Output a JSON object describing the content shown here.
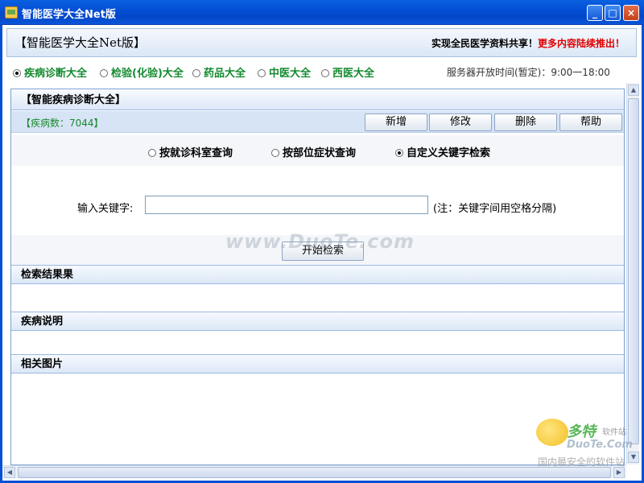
{
  "window": {
    "title": "智能医学大全Net版",
    "controls": {
      "minimize": "_",
      "maximize": "□",
      "close": "×"
    }
  },
  "header": {
    "brand": "【智能医学大全Net版】",
    "slogan_black": "实现全民医学资料共享！",
    "slogan_red": "更多内容陆续推出！"
  },
  "nav": {
    "items": [
      {
        "label": "疾病诊断大全",
        "selected": true
      },
      {
        "label": "检验(化验)大全",
        "selected": false
      },
      {
        "label": "药品大全",
        "selected": false
      },
      {
        "label": "中医大全",
        "selected": false
      },
      {
        "label": "西医大全",
        "selected": false
      }
    ],
    "server_time": "服务器开放时间(暂定)：9:00一18:00"
  },
  "panel": {
    "title": "【智能疾病诊断大全】",
    "count": "【疾病数：7044】",
    "buttons": [
      "新增",
      "修改",
      "删除",
      "帮助"
    ],
    "modes": [
      {
        "label": "按就诊科室查询",
        "selected": false
      },
      {
        "label": "按部位症状查询",
        "selected": false
      },
      {
        "label": "自定义关键字检索",
        "selected": true
      }
    ],
    "keyword_label": "输入关键字:",
    "keyword_value": "",
    "keyword_note": "(注：关键字间用空格分隔)",
    "search_button": "开始检索",
    "results_title": "检索结果果",
    "description_title": "疾病说明",
    "images_title": "相关图片"
  },
  "scrollbar": {
    "up": "▲",
    "down": "▼",
    "left": "◀",
    "right": "▶"
  },
  "watermarks": {
    "center": "www.DuoTe.com",
    "brand": "多特",
    "brand_sub": "软件站",
    "domain": "DuoTe.Com",
    "tagline": "国内最安全的软件站"
  },
  "colors": {
    "titlebar": "#0450d6",
    "nav_text": "#138a2e",
    "count_text": "#1a8a2e",
    "accent_red": "#e00000"
  }
}
